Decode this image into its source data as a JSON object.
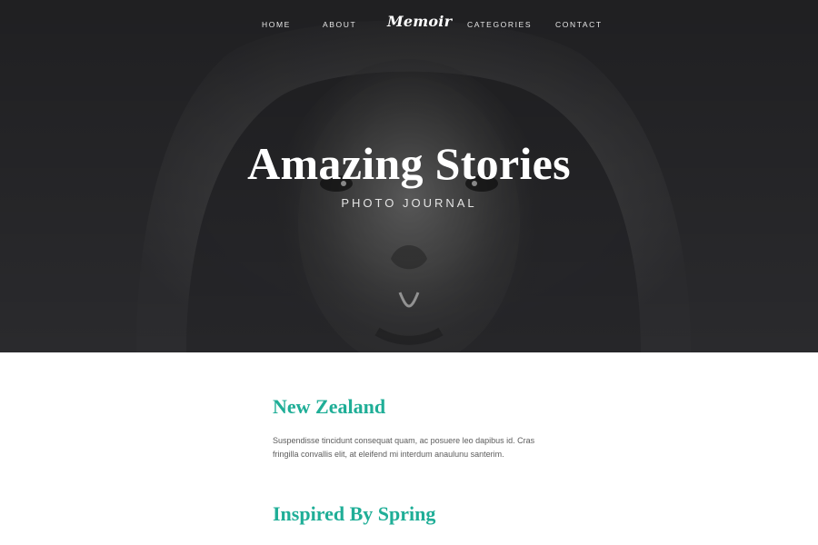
{
  "nav": {
    "home": "HOME",
    "about": "ABOUT",
    "logo": "Memoir",
    "categories": "CATEGORIES",
    "contact": "CONTACT"
  },
  "hero": {
    "title": "Amazing Stories",
    "subtitle": "PHOTO JOURNAL"
  },
  "posts": [
    {
      "title": "New Zealand",
      "excerpt": "Suspendisse tincidunt consequat quam, ac posuere leo dapibus id. Cras fringilla convallis elit, at eleifend mi interdum anaulunu santerim."
    },
    {
      "title": "Inspired By Spring"
    }
  ],
  "colors": {
    "accent": "#1fae97",
    "hero_background": "#29292c",
    "nav_text": "#e7e7e7",
    "body_text": "#5c5c5c"
  }
}
